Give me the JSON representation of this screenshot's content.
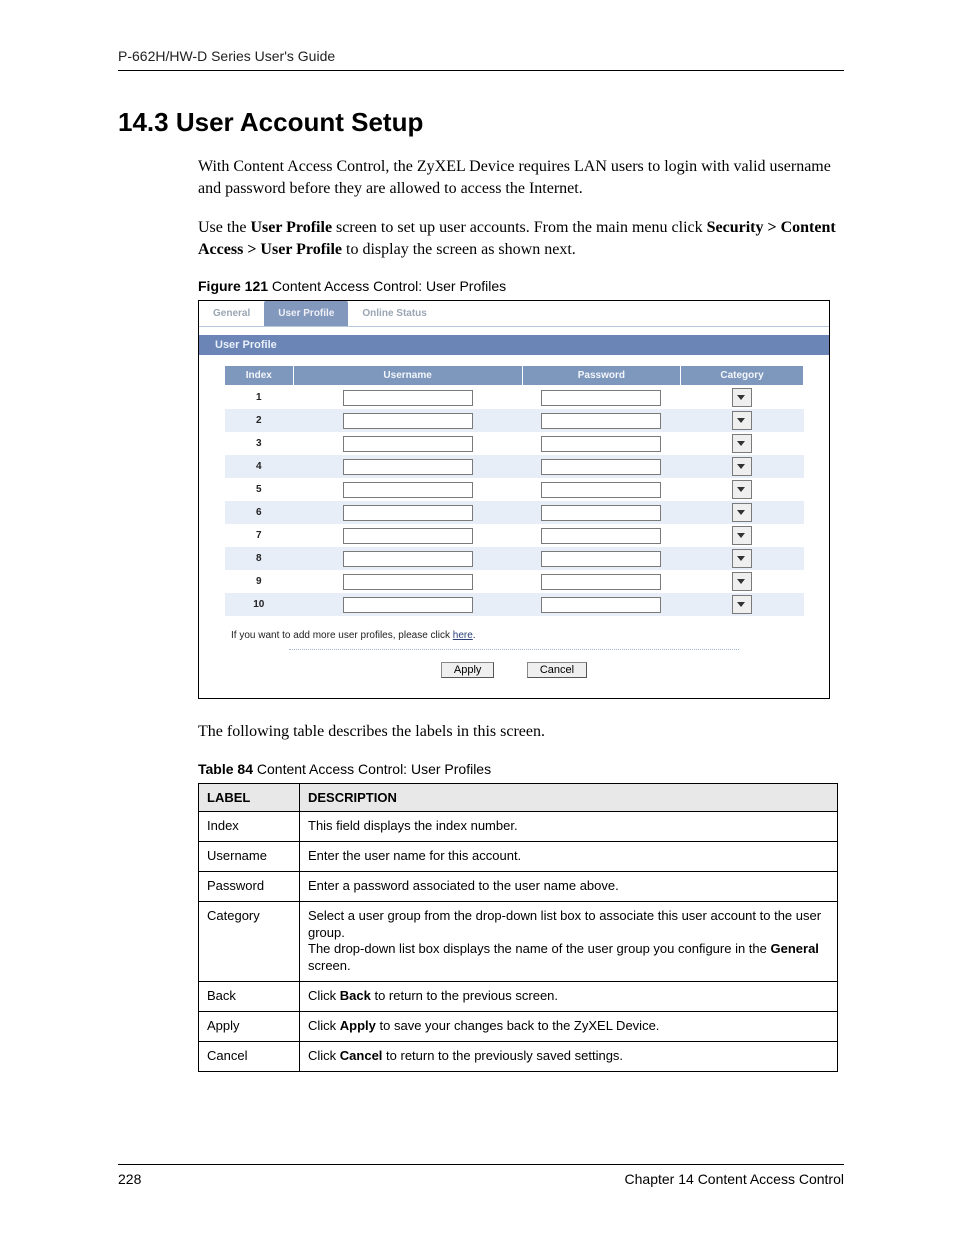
{
  "header": "P-662H/HW-D Series User's Guide",
  "h1": "14.3  User Account Setup",
  "para1": "With Content Access Control, the ZyXEL Device requires LAN users to login with valid username and password before they are allowed to access the Internet.",
  "para2_a": "Use the ",
  "para2_b": "User Profile",
  "para2_c": " screen to set up user accounts. From the main menu click ",
  "para2_d": "Security > Content Access > User Profile",
  "para2_e": " to display the screen as shown next.",
  "fig_label": "Figure 121",
  "fig_title": "   Content Access Control: User Profiles",
  "tabs": {
    "general": "General",
    "user_profile": "User Profile",
    "online_status": "Online Status"
  },
  "panel_title": "User Profile",
  "columns": {
    "index": "Index",
    "username": "Username",
    "password": "Password",
    "category": "Category"
  },
  "rows": [
    {
      "index": "1",
      "username": "",
      "password": "",
      "category": ""
    },
    {
      "index": "2",
      "username": "",
      "password": "",
      "category": ""
    },
    {
      "index": "3",
      "username": "",
      "password": "",
      "category": ""
    },
    {
      "index": "4",
      "username": "",
      "password": "",
      "category": ""
    },
    {
      "index": "5",
      "username": "",
      "password": "",
      "category": ""
    },
    {
      "index": "6",
      "username": "",
      "password": "",
      "category": ""
    },
    {
      "index": "7",
      "username": "",
      "password": "",
      "category": ""
    },
    {
      "index": "8",
      "username": "",
      "password": "",
      "category": ""
    },
    {
      "index": "9",
      "username": "",
      "password": "",
      "category": ""
    },
    {
      "index": "10",
      "username": "",
      "password": "",
      "category": ""
    }
  ],
  "add_note_a": "If you want to add more user profiles, please click ",
  "add_note_link": "here",
  "add_note_b": ".",
  "btn_apply": "Apply",
  "btn_cancel": "Cancel",
  "post_fig_para": "The following table describes the labels in this screen.",
  "tbl_label": "Table 84",
  "tbl_title": "   Content Access Control: User Profiles",
  "tbl_head_label": "LABEL",
  "tbl_head_desc": "DESCRIPTION",
  "tbl": [
    {
      "label": "Index",
      "desc_plain": "This field displays the index number."
    },
    {
      "label": "Username",
      "desc_plain": "Enter the user name for this account."
    },
    {
      "label": "Password",
      "desc_plain": "Enter a password associated to the user name above."
    },
    {
      "label": "Category",
      "line1": "Select a user group from the drop-down list box to associate this user account to the user group.",
      "line2_a": "The drop-down list box displays the name of the user group you configure in the ",
      "line2_b": "General",
      "line2_c": " screen."
    },
    {
      "label": "Back",
      "pre": "Click ",
      "bold": "Back",
      "post": " to return to the previous screen."
    },
    {
      "label": "Apply",
      "pre": "Click ",
      "bold": "Apply",
      "post": " to save your changes back to the ZyXEL Device."
    },
    {
      "label": "Cancel",
      "pre": "Click ",
      "bold": "Cancel",
      "post": " to return to the previously saved settings."
    }
  ],
  "footer_page": "228",
  "footer_chapter": "Chapter 14 Content Access Control"
}
